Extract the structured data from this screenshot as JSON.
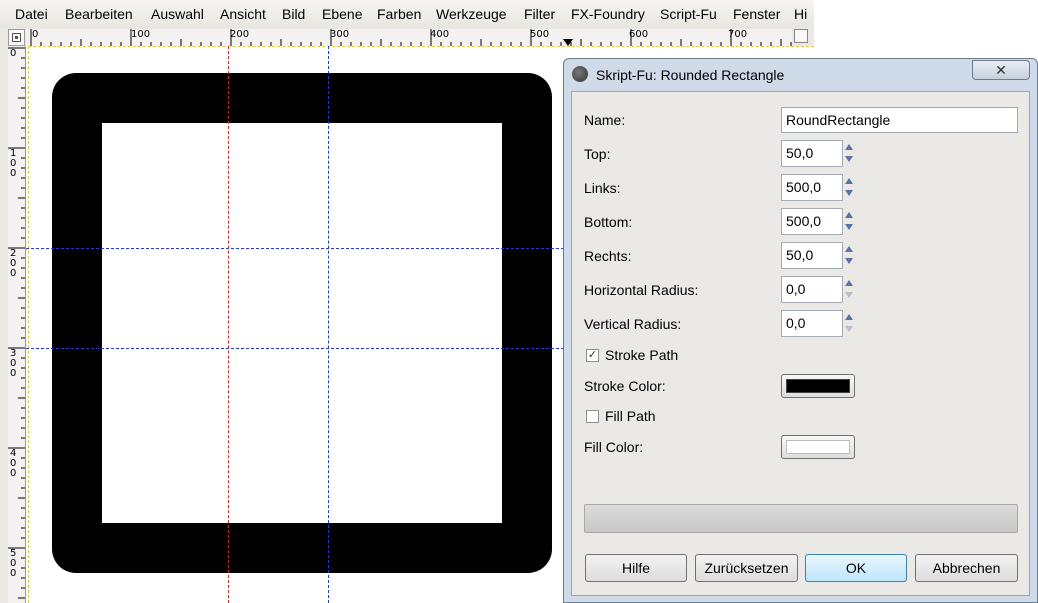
{
  "menubar": {
    "items": [
      {
        "label": "Datei"
      },
      {
        "label": "Bearbeiten"
      },
      {
        "label": "Auswahl"
      },
      {
        "label": "Ansicht"
      },
      {
        "label": "Bild"
      },
      {
        "label": "Ebene"
      },
      {
        "label": "Farben"
      },
      {
        "label": "Werkzeuge"
      },
      {
        "label": "Filter"
      },
      {
        "label": "FX-Foundry"
      },
      {
        "label": "Script-Fu"
      },
      {
        "label": "Fenster"
      },
      {
        "label": "Hi"
      }
    ]
  },
  "ruler": {
    "h_labels": [
      "0",
      "100",
      "200",
      "300",
      "400",
      "500",
      "600",
      "700"
    ],
    "v_labels": [
      "0",
      "1\n0\n0",
      "2\n0\n0",
      "3\n0\n0",
      "4\n0\n0",
      "5\n0\n0"
    ]
  },
  "canvas": {
    "shape_color": "#000000",
    "fill_color": "#ffffff",
    "guide_colors": [
      "#d62222",
      "#1f3ad6"
    ]
  },
  "dialog": {
    "title": "Skript-Fu: Rounded Rectangle",
    "close_icon": "close-x",
    "name_label": "Name:",
    "name_value": "RoundRectangle",
    "fields": [
      {
        "label": "Top:",
        "value": "50,0"
      },
      {
        "label": "Links:",
        "value": "500,0"
      },
      {
        "label": "Bottom:",
        "value": "500,0"
      },
      {
        "label": "Rechts:",
        "value": "50,0"
      },
      {
        "label": "Horizontal Radius:",
        "value": "0,0"
      },
      {
        "label": "Vertical Radius:",
        "value": "0,0"
      }
    ],
    "stroke_path": {
      "label": "Stroke Path",
      "checked": true
    },
    "stroke_color": {
      "label": "Stroke Color:",
      "value": "#000000"
    },
    "fill_path": {
      "label": "Fill Path",
      "checked": false
    },
    "fill_color": {
      "label": "Fill Color:",
      "value": "#ffffff"
    },
    "buttons": {
      "help": "Hilfe",
      "reset": "Zurücksetzen",
      "ok": "OK",
      "cancel": "Abbrechen"
    }
  }
}
